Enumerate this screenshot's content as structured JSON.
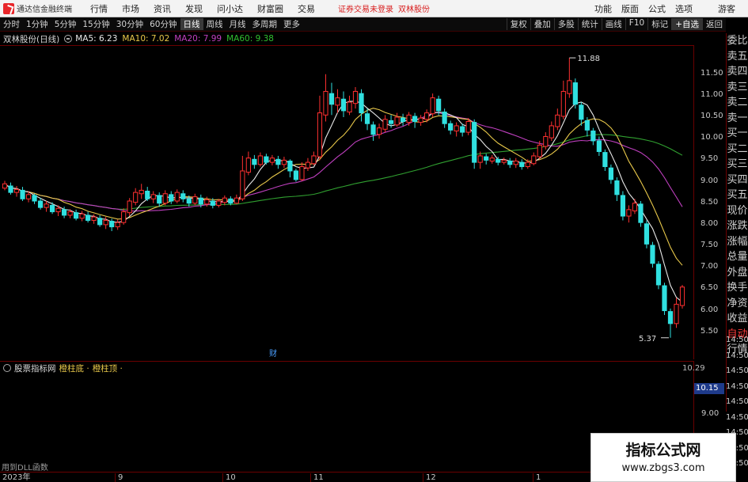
{
  "menubar": {
    "app_title": "通达信金融终端",
    "menus": [
      "行情",
      "市场",
      "资讯",
      "发现",
      "问小达",
      "财富圈",
      "交易"
    ],
    "notice": "证券交易未登录",
    "stock": "双林股份",
    "right_menus": [
      "功能",
      "版面",
      "公式",
      "选项"
    ],
    "guest": "游客"
  },
  "periodbar": {
    "periods": [
      "分时",
      "1分钟",
      "5分钟",
      "15分钟",
      "30分钟",
      "60分钟",
      "日线",
      "周线",
      "月线",
      "多周期",
      "更多"
    ],
    "active_period": "日线",
    "right_buttons": [
      "复权",
      "叠加",
      "多股",
      "统计",
      "画线",
      "F10",
      "标记",
      "+自选",
      "返回"
    ]
  },
  "chart_header": {
    "name": "双林股份(日线)",
    "ma5": "MA5: 6.23",
    "ma10": "MA10: 7.02",
    "ma20": "MA20: 7.99",
    "ma60": "MA60: 9.38"
  },
  "colors": {
    "ma5": "#e8e8e8",
    "ma10": "#e8c84a",
    "ma20": "#c040c0",
    "ma60": "#30a030",
    "up": "#ff3030",
    "down": "#30e0e0"
  },
  "side_panel": [
    "委比",
    "卖五",
    "卖四",
    "卖三",
    "卖二",
    "卖一",
    "买一",
    "买二",
    "买三",
    "买四",
    "买五",
    "现价",
    "涨跌",
    "涨幅",
    "总量",
    "外盘",
    "换手",
    "净资",
    "收益",
    "自动",
    "行情"
  ],
  "lower_labels": [
    "14:50",
    "14:50",
    "14:50",
    "14:50",
    "14:50",
    "14:50",
    "14:50",
    "14:50",
    "14:50"
  ],
  "price_axis": [
    "11.50",
    "11.00",
    "10.50",
    "10.00",
    "9.50",
    "9.00",
    "8.50",
    "8.00",
    "7.50",
    "7.00",
    "6.50",
    "6.00",
    "5.50"
  ],
  "annotations": {
    "high": "11.88",
    "low": "5.37",
    "event": "财"
  },
  "indicator": {
    "name": "股票指标网",
    "a": "橙柱底 ·",
    "b": "橙柱顶 ·",
    "value": "10.15",
    "tick": "9.00",
    "corner": "10.29"
  },
  "dll_note": "用到DLL函数",
  "date_axis": [
    "2023年",
    "9",
    "10",
    "11",
    "12",
    "1"
  ],
  "watermark": {
    "line1": "指标公式网",
    "line2": "www.zbgs3.com"
  },
  "chart_data": {
    "type": "candlestick",
    "y_range": [
      5.2,
      11.9
    ],
    "price_high": 11.88,
    "price_low": 5.37,
    "candles": [
      [
        8.85,
        8.95,
        8.8,
        9.02
      ],
      [
        8.9,
        8.75,
        8.7,
        8.98
      ],
      [
        8.75,
        8.82,
        8.65,
        8.9
      ],
      [
        8.8,
        8.6,
        8.55,
        8.88
      ],
      [
        8.6,
        8.7,
        8.52,
        8.78
      ],
      [
        8.68,
        8.55,
        8.48,
        8.72
      ],
      [
        8.55,
        8.4,
        8.35,
        8.62
      ],
      [
        8.4,
        8.48,
        8.3,
        8.55
      ],
      [
        8.45,
        8.3,
        8.25,
        8.52
      ],
      [
        8.3,
        8.38,
        8.2,
        8.45
      ],
      [
        8.35,
        8.22,
        8.15,
        8.42
      ],
      [
        8.22,
        8.3,
        8.15,
        8.36
      ],
      [
        8.28,
        8.15,
        8.1,
        8.35
      ],
      [
        8.15,
        8.25,
        8.08,
        8.32
      ],
      [
        8.22,
        8.1,
        8.05,
        8.3
      ],
      [
        8.1,
        8.18,
        8.02,
        8.24
      ],
      [
        8.15,
        8.0,
        7.95,
        8.22
      ],
      [
        8.0,
        8.1,
        7.9,
        8.18
      ],
      [
        8.08,
        7.95,
        7.85,
        8.14
      ],
      [
        7.95,
        8.05,
        7.88,
        8.12
      ],
      [
        8.05,
        8.3,
        8.0,
        8.38
      ],
      [
        8.28,
        8.55,
        8.2,
        8.62
      ],
      [
        8.52,
        8.75,
        8.45,
        8.85
      ],
      [
        8.72,
        8.8,
        8.6,
        8.95
      ],
      [
        8.78,
        8.6,
        8.55,
        8.88
      ],
      [
        8.6,
        8.7,
        8.5,
        8.78
      ],
      [
        8.68,
        8.5,
        8.42,
        8.75
      ],
      [
        8.5,
        8.72,
        8.45,
        8.8
      ],
      [
        8.7,
        8.55,
        8.48,
        8.78
      ],
      [
        8.55,
        8.75,
        8.5,
        8.82
      ],
      [
        8.72,
        8.6,
        8.52,
        8.8
      ],
      [
        8.6,
        8.5,
        8.42,
        8.68
      ],
      [
        8.5,
        8.65,
        8.45,
        8.72
      ],
      [
        8.62,
        8.48,
        8.4,
        8.7
      ],
      [
        8.48,
        8.58,
        8.42,
        8.65
      ],
      [
        8.55,
        8.45,
        8.38,
        8.62
      ],
      [
        8.45,
        8.55,
        8.4,
        8.6
      ],
      [
        8.52,
        8.62,
        8.45,
        8.68
      ],
      [
        8.6,
        8.5,
        8.45,
        8.66
      ],
      [
        8.5,
        8.62,
        8.48,
        8.7
      ],
      [
        8.6,
        9.25,
        8.55,
        9.6
      ],
      [
        9.22,
        9.55,
        9.15,
        9.7
      ],
      [
        9.52,
        9.4,
        9.3,
        9.62
      ],
      [
        9.4,
        9.6,
        9.35,
        9.68
      ],
      [
        9.58,
        9.45,
        9.4,
        9.65
      ],
      [
        9.45,
        9.55,
        9.38,
        9.62
      ],
      [
        9.52,
        9.4,
        9.3,
        9.6
      ],
      [
        9.4,
        9.5,
        9.32,
        9.58
      ],
      [
        9.48,
        9.25,
        9.1,
        9.52
      ],
      [
        9.25,
        9.05,
        9.0,
        9.3
      ],
      [
        9.05,
        9.35,
        9.02,
        9.45
      ],
      [
        9.32,
        9.45,
        9.25,
        9.55
      ],
      [
        9.42,
        9.6,
        9.38,
        9.7
      ],
      [
        9.58,
        10.6,
        9.5,
        11.0
      ],
      [
        10.55,
        11.1,
        10.4,
        11.5
      ],
      [
        11.05,
        10.8,
        10.55,
        11.3
      ],
      [
        10.78,
        10.95,
        10.6,
        11.15
      ],
      [
        10.92,
        10.65,
        10.5,
        11.1
      ],
      [
        10.62,
        10.85,
        10.55,
        11.0
      ],
      [
        10.82,
        11.1,
        10.7,
        11.2
      ],
      [
        11.05,
        10.6,
        10.4,
        11.15
      ],
      [
        10.58,
        10.35,
        10.2,
        10.7
      ],
      [
        10.32,
        10.1,
        9.95,
        10.4
      ],
      [
        10.1,
        10.25,
        10.0,
        10.35
      ],
      [
        10.22,
        10.45,
        10.15,
        10.55
      ],
      [
        10.42,
        10.35,
        10.25,
        10.55
      ],
      [
        10.32,
        10.5,
        10.28,
        10.6
      ],
      [
        10.48,
        10.4,
        10.3,
        10.58
      ],
      [
        10.38,
        10.55,
        10.3,
        10.62
      ],
      [
        10.52,
        10.4,
        10.25,
        10.6
      ],
      [
        10.38,
        10.48,
        10.3,
        10.55
      ],
      [
        10.45,
        10.6,
        10.38,
        10.68
      ],
      [
        10.58,
        10.95,
        10.5,
        11.05
      ],
      [
        10.92,
        10.65,
        10.55,
        11.0
      ],
      [
        10.62,
        10.35,
        10.25,
        10.7
      ],
      [
        10.35,
        10.2,
        10.1,
        10.42
      ],
      [
        10.18,
        10.3,
        10.05,
        10.38
      ],
      [
        10.28,
        10.15,
        10.05,
        10.35
      ],
      [
        10.15,
        10.4,
        10.08,
        10.48
      ],
      [
        10.38,
        9.45,
        9.3,
        10.45
      ],
      [
        9.45,
        9.6,
        9.3,
        9.7
      ],
      [
        9.58,
        9.5,
        9.4,
        9.65
      ],
      [
        9.48,
        9.55,
        9.42,
        9.62
      ],
      [
        9.52,
        9.45,
        9.38,
        9.58
      ],
      [
        9.45,
        9.5,
        9.4,
        9.56
      ],
      [
        9.48,
        9.4,
        9.32,
        9.55
      ],
      [
        9.4,
        9.48,
        9.32,
        9.55
      ],
      [
        9.45,
        9.35,
        9.28,
        9.52
      ],
      [
        9.35,
        9.45,
        9.3,
        9.52
      ],
      [
        9.42,
        9.6,
        9.38,
        9.68
      ],
      [
        9.58,
        9.85,
        9.52,
        9.95
      ],
      [
        9.82,
        10.05,
        9.75,
        10.15
      ],
      [
        10.02,
        10.3,
        9.95,
        10.4
      ],
      [
        10.28,
        10.55,
        10.2,
        10.7
      ],
      [
        10.52,
        11.1,
        10.45,
        11.35
      ],
      [
        11.05,
        11.35,
        10.95,
        11.88
      ],
      [
        11.3,
        10.8,
        10.7,
        11.4
      ],
      [
        10.78,
        10.45,
        10.3,
        10.85
      ],
      [
        10.42,
        10.2,
        10.05,
        10.5
      ],
      [
        10.18,
        9.95,
        9.85,
        10.25
      ],
      [
        9.95,
        9.7,
        9.6,
        10.05
      ],
      [
        9.68,
        9.35,
        9.25,
        9.75
      ],
      [
        9.32,
        9.05,
        8.95,
        9.4
      ],
      [
        9.02,
        8.7,
        8.55,
        9.1
      ],
      [
        8.68,
        8.2,
        8.1,
        8.78
      ],
      [
        8.2,
        8.35,
        8.05,
        8.45
      ],
      [
        8.32,
        8.5,
        8.25,
        8.6
      ],
      [
        8.48,
        8.05,
        7.95,
        8.55
      ],
      [
        8.02,
        7.55,
        7.45,
        8.1
      ],
      [
        7.52,
        7.1,
        7.0,
        7.6
      ],
      [
        7.08,
        6.6,
        6.5,
        7.15
      ],
      [
        6.58,
        6.0,
        5.9,
        6.65
      ],
      [
        5.98,
        5.7,
        5.37,
        6.05
      ],
      [
        5.7,
        6.15,
        5.6,
        6.3
      ],
      [
        6.12,
        6.55,
        6.05,
        6.6
      ]
    ]
  }
}
